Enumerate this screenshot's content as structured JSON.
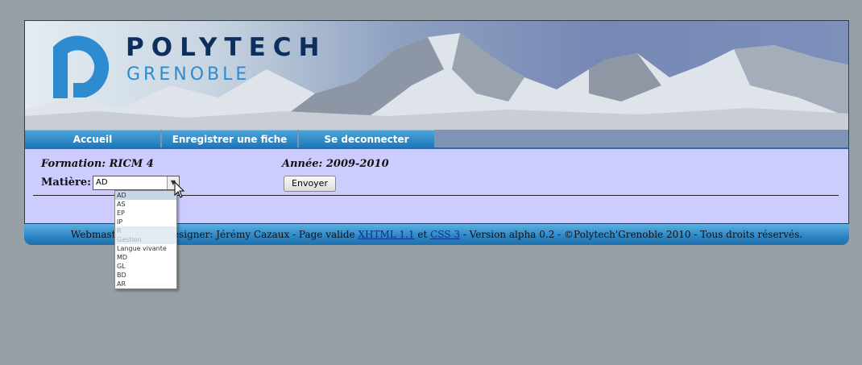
{
  "header": {
    "brand_name": "POLYTECH",
    "brand_city": "GRENOBLE"
  },
  "nav": {
    "items": [
      {
        "label": "Accueil"
      },
      {
        "label": "Enregistrer une fiche"
      },
      {
        "label": "Se deconnecter"
      }
    ]
  },
  "form": {
    "formation_label": "Formation: RICM 4",
    "annee_label": "Année: 2009-2010",
    "matiere_label": "Matière:",
    "select_value": "AD",
    "submit_label": "Envoyer"
  },
  "dropdown": {
    "options": [
      "AD",
      "AS",
      "EP",
      "IP",
      "R",
      "Gestion",
      "Langue vivante",
      "MD",
      "GL",
      "BD",
      "AR"
    ]
  },
  "footer": {
    "text_start": "Webmaster, codeur,designer: Jérémy Cazaux - Page valide ",
    "link_xhtml": "XHTML 1.1",
    "text_and": " et ",
    "link_css": "CSS 3",
    "text_end": " - Version alpha 0.2  - ©Polytech'Grenoble 2010 - Tous droits réservés."
  },
  "colors": {
    "nav_button": "#2a86c6",
    "content_bg": "#ccccff",
    "page_bg": "#96a0a6",
    "brand_dark": "#0e2f5e",
    "brand_light": "#2d8bd0"
  }
}
